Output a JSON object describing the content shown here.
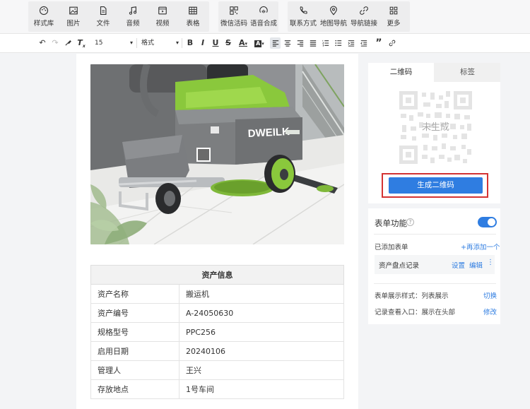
{
  "toolbar": {
    "items": [
      {
        "label": "样式库",
        "icon": "palette-icon"
      },
      {
        "label": "图片",
        "icon": "image-icon"
      },
      {
        "label": "文件",
        "icon": "file-icon"
      },
      {
        "label": "音频",
        "icon": "music-icon"
      },
      {
        "label": "视频",
        "icon": "video-icon"
      },
      {
        "label": "表格",
        "icon": "table-icon"
      },
      {
        "label": "微信活码",
        "icon": "qrcode-icon"
      },
      {
        "label": "语音合成",
        "icon": "voice-icon"
      },
      {
        "label": "联系方式",
        "icon": "phone-icon"
      },
      {
        "label": "地图导航",
        "icon": "map-pin-icon"
      },
      {
        "label": "导航链接",
        "icon": "link-icon"
      },
      {
        "label": "更多",
        "icon": "grid-icon"
      }
    ]
  },
  "format_bar": {
    "font_size": "15",
    "style_select": "格式"
  },
  "product": {
    "brand_text": "DWEILK"
  },
  "asset_table": {
    "title": "资产信息",
    "rows": [
      {
        "key": "资产名称",
        "value": "搬运机"
      },
      {
        "key": "资产编号",
        "value": "A-24050630"
      },
      {
        "key": "规格型号",
        "value": "PPC256"
      },
      {
        "key": "启用日期",
        "value": "20240106"
      },
      {
        "key": "管理人",
        "value": "王兴"
      },
      {
        "key": "存放地点",
        "value": "1号车间"
      }
    ]
  },
  "qr_panel": {
    "tabs": [
      {
        "label": "二维码",
        "active": true
      },
      {
        "label": "标签",
        "active": false
      }
    ],
    "placeholder": "未生成",
    "generate_button": "生成二维码"
  },
  "form_panel": {
    "title": "表单功能",
    "help": "?",
    "toggle_on": true,
    "added_label": "已添加表单",
    "add_link": "+再添加一个",
    "form_item": {
      "name": "资产盘点记录",
      "setting": "设置",
      "edit": "编辑",
      "more": "⋮"
    },
    "display_style": "表单展示样式：列表展示",
    "display_action": "切换",
    "entry": "记录查看入口：展示在头部",
    "entry_action": "修改"
  },
  "colors": {
    "accent": "#2f7de1",
    "highlight_frame": "#d43333",
    "machine_green": "#8ac83c"
  }
}
